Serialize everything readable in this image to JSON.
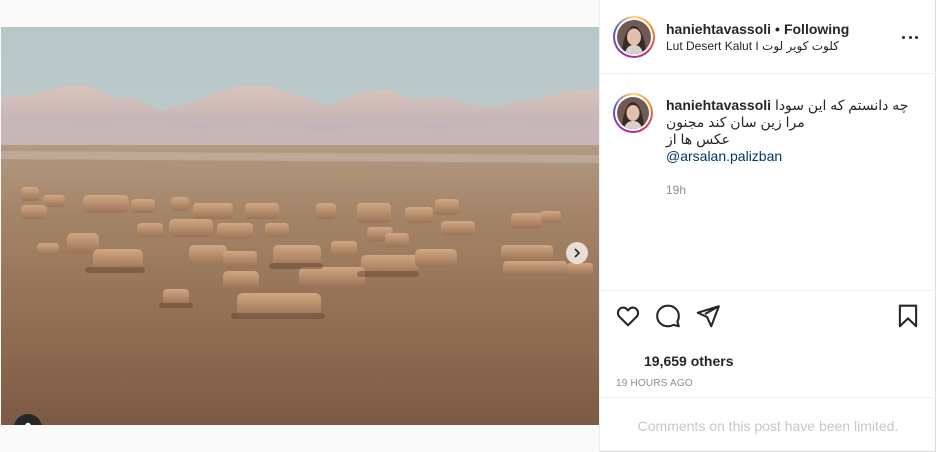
{
  "post": {
    "username": "haniehtavassoli",
    "separator": "•",
    "follow_status": "Following",
    "location": "Lut Desert Kalut I کلوت کویر لوت",
    "caption": {
      "username": "haniehtavassoli",
      "lines": [
        "چه دانستم که این سودا",
        "مرا زین سان کند مجنون",
        "عکس ها از"
      ],
      "mention": "@arsalan.palizban",
      "time": "19h"
    },
    "likes": "19,659 others",
    "posted": "19 HOURS AGO",
    "comments_notice": "Comments on this post have been limited."
  },
  "carousel": {
    "slide_count": 4,
    "active_slide": 1
  },
  "icons": {
    "like": "heart-icon",
    "comment": "comment-icon",
    "share": "paper-plane-icon",
    "save": "bookmark-icon",
    "more": "more-options-icon",
    "next": "chevron-right-icon",
    "tag": "user-tag-icon"
  },
  "colors": {
    "text": "#262626",
    "secondary": "#8e8e8e",
    "link": "#00376b",
    "border": "#dbdbdb",
    "muted": "#c7c7c7"
  }
}
